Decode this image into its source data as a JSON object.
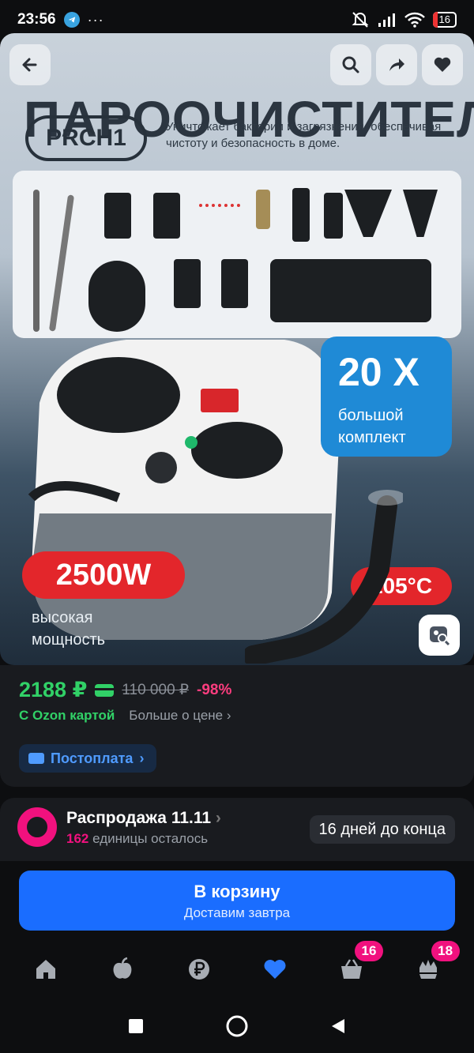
{
  "status": {
    "time": "23:56",
    "more": "···",
    "battery": "16"
  },
  "hero": {
    "title_banner": "ПАРООЧИСТИТЕЛЬ",
    "model": "PRCH1",
    "description": "Уничтожает бактерии и загрязнения, обеспечивая чистоту и безопасность в доме.",
    "kit_count": "20 X",
    "kit_label_1": "большой",
    "kit_label_2": "комплект",
    "power": "2500W",
    "power_label_1": "высокая",
    "power_label_2": "мощность",
    "temperature": "105°C"
  },
  "price": {
    "current": "2188 ₽",
    "old": "110 000 ₽",
    "discount": "-98%",
    "ozon_card": "С Ozon картой",
    "more": "Больше о цене",
    "more_chevron": "›",
    "postpay": "Постоплата",
    "postpay_chevron": "›"
  },
  "sale": {
    "title": "Распродажа 11.11",
    "title_chevron": "›",
    "left_count": "162",
    "left_text": "единицы осталось",
    "days_left": "16 дней до конца"
  },
  "cart": {
    "button": "В корзину",
    "delivery": "Доставим завтра"
  },
  "bottom_nav": {
    "cart_count": "16",
    "profile_count": "18"
  },
  "colors": {
    "accent_green": "#31d167",
    "accent_pink": "#f1117e",
    "accent_blue": "#1a6dff",
    "badge_red": "#e3262b"
  }
}
